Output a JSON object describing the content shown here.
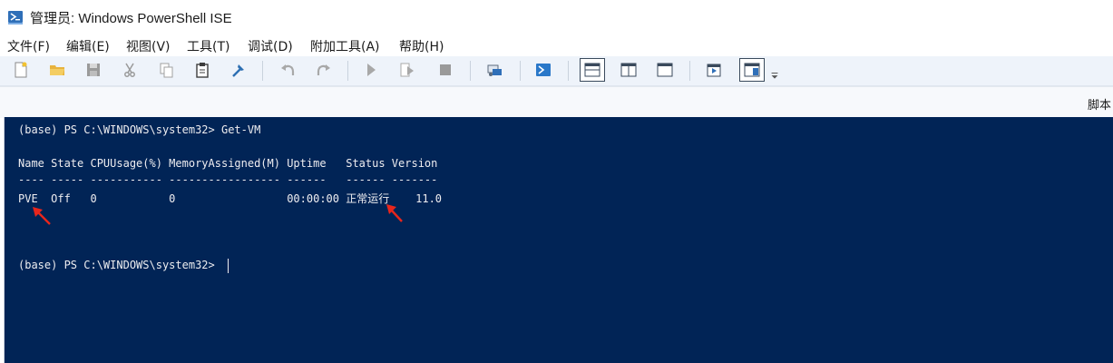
{
  "window": {
    "title": "管理员: Windows PowerShell ISE"
  },
  "menu": {
    "items": [
      "文件(F)",
      "编辑(E)",
      "视图(V)",
      "工具(T)",
      "调试(D)",
      "附加工具(A)",
      "帮助(H)"
    ]
  },
  "toolbar": {
    "buttons": [
      "new-file-icon",
      "open-folder-icon",
      "save-icon",
      "cut-icon",
      "copy-icon",
      "paste-icon",
      "clear-icon",
      "undo-icon",
      "redo-icon",
      "run-icon",
      "run-selection-icon",
      "stop-icon",
      "remote-powershell-icon",
      "powershell-console-icon",
      "layout-top-icon",
      "layout-right-icon",
      "layout-max-icon",
      "show-script-icon",
      "show-console-icon",
      "overflow-icon"
    ]
  },
  "tabs": {
    "script_tab_label": "脚本"
  },
  "console": {
    "lines": [
      "(base) PS C:\\WINDOWS\\system32> Get-VM",
      "Name State CPUUsage(%) MemoryAssigned(M) Uptime   Status Version",
      "---- ----- ----------- ----------------- ------   ------ -------",
      "PVE  Off   0           0                 00:00:00 正常运行    11.0",
      "(base) PS C:\\WINDOWS\\system32> "
    ]
  },
  "colors": {
    "console_background": "#012456",
    "console_text": "#eeedf0",
    "annotation_arrow": "#e8261c",
    "toolbar_background": "#eef3fa"
  }
}
